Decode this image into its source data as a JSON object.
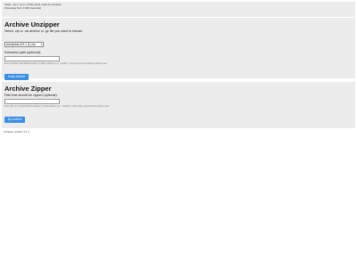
{
  "status": {
    "line1": "Status: .zip or .gz or .rar files found, ready for extraction",
    "line2": "Processing Time: 0.0001 Second(s)"
  },
  "unzipper": {
    "title": "Archive Unzipper",
    "select_label": "Select .zip or .rar archive or .gz file you want to extract:",
    "selected_option": "wordpress-5.0.1 (1).zip",
    "path_label": "Extraction path (optional):",
    "path_value": "",
    "hint": "Enter extraction path without leading or trailing slashes (e.g. \"mypath\"). If left empty current directory will be used.",
    "button_label": "Unzip Archive"
  },
  "zipper": {
    "title": "Archive Zipper",
    "path_label": "Path that should be zipped (optional):",
    "path_value": "",
    "hint": "Enter path to be zipped without leading or trailing slashes (e.g. \"zippath\"). If left empty current directory will be used.",
    "button_label": "Zip Archive"
  },
  "footer": {
    "version": "Unzipper version: 0.1.1"
  },
  "colors": {
    "card_bg": "#ececec",
    "button_bg": "#3b8fe3"
  }
}
